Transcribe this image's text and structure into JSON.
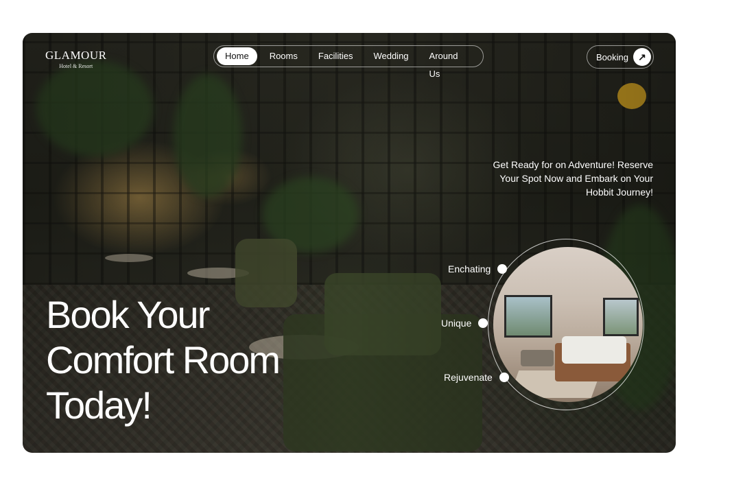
{
  "brand": {
    "name": "GLAMOUR",
    "subtitle": "Hotel & Resort"
  },
  "nav": {
    "items": [
      {
        "label": "Home",
        "active": true
      },
      {
        "label": "Rooms",
        "active": false
      },
      {
        "label": "Facilities",
        "active": false
      },
      {
        "label": "Wedding",
        "active": false
      },
      {
        "label": "Around Us",
        "active": false
      }
    ]
  },
  "booking": {
    "label": "Booking",
    "icon": "arrow-up-right-icon",
    "arrow_glyph": "↗"
  },
  "tagline": {
    "lines": [
      "Get Ready for on Adventure! Reserve",
      "Your Spot Now and Embark on Your",
      "Hobbit Journey!"
    ]
  },
  "headline": {
    "lines": [
      "Book Your",
      "Comfort Room",
      "Today!"
    ]
  },
  "features": [
    {
      "label": "Enchating"
    },
    {
      "label": "Unique"
    },
    {
      "label": "Rejuvenate"
    }
  ],
  "colors": {
    "accent": "#c79a22",
    "text": "#ffffff",
    "page_background": "#ffffff"
  }
}
